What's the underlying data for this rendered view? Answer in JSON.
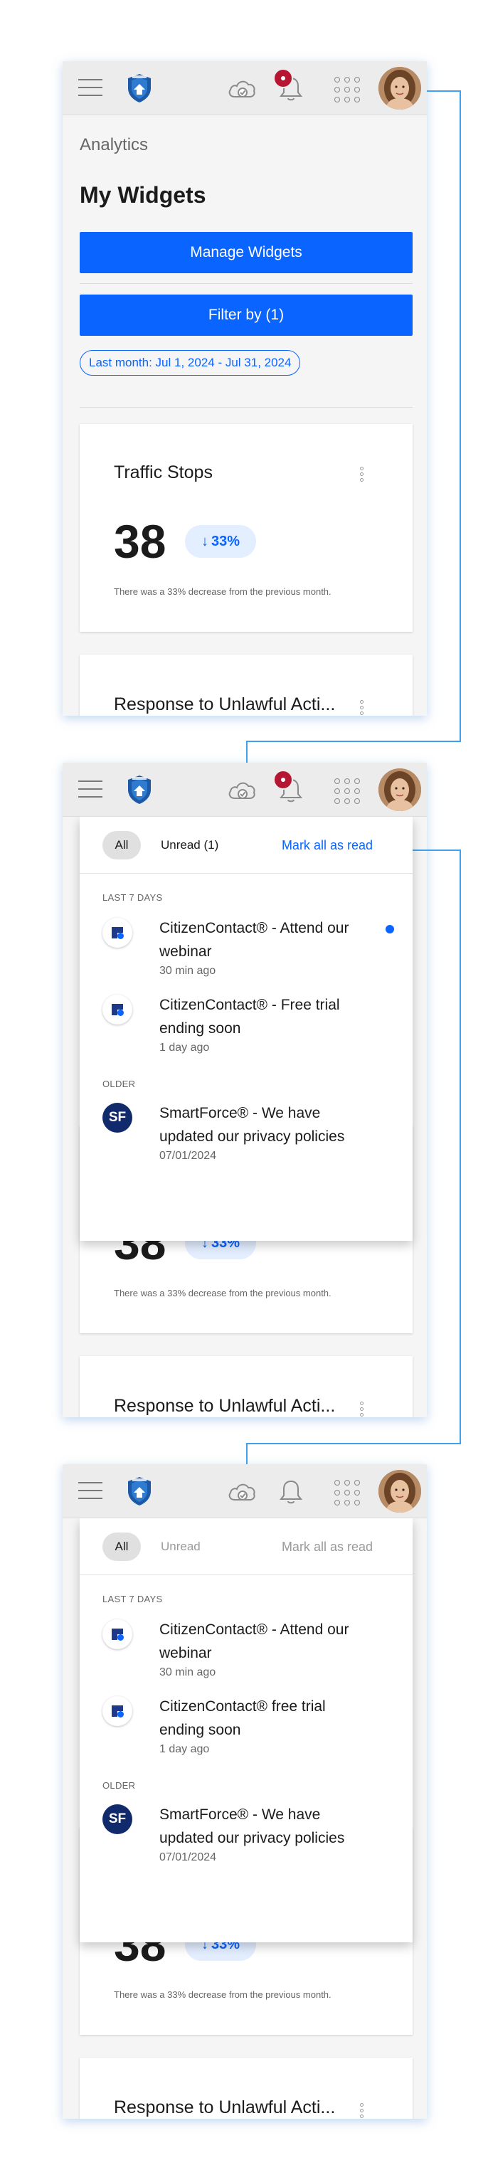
{
  "header": {
    "logo": "police-badge-logo",
    "icons": [
      "menu-icon",
      "cloud-check-icon",
      "bell-icon",
      "apps-grid-icon"
    ],
    "avatar": "user-avatar"
  },
  "page": {
    "breadcrumb": "Analytics",
    "title": "My Widgets",
    "manage_label": "Manage Widgets",
    "filter_label": "Filter by (1)",
    "date_chip": "Last month: Jul 1, 2024 - Jul 31, 2024"
  },
  "widgets": [
    {
      "title": "Traffic Stops",
      "value": "38",
      "trend": "33%",
      "trend_direction": "down",
      "note": "There was a 33% decrease from the previous month."
    },
    {
      "title": "Response to Unlawful Acti..."
    }
  ],
  "notifications_unread_state": {
    "tabs": {
      "all": "All",
      "unread": "Unread (1)"
    },
    "mark_all": "Mark all as read",
    "sections": [
      {
        "label": "LAST 7 DAYS",
        "items": [
          {
            "icon": "citizencontact-icon",
            "title": "CitizenContact® - Attend our webinar",
            "time": "30 min ago",
            "unread": true
          },
          {
            "icon": "citizencontact-icon",
            "title": "CitizenContact® - Free trial ending soon",
            "time": "1 day ago",
            "unread": false
          }
        ]
      },
      {
        "label": "OLDER",
        "items": [
          {
            "icon": "smartforce-icon",
            "icon_text": "SF",
            "title": "SmartForce® - We have updated our privacy policies",
            "time": "07/01/2024",
            "unread": false
          }
        ]
      }
    ]
  },
  "notifications_read_state": {
    "tabs": {
      "all": "All",
      "unread": "Unread"
    },
    "mark_all": "Mark all as read",
    "sections": [
      {
        "label": "LAST 7 DAYS",
        "items": [
          {
            "icon": "citizencontact-icon",
            "title": "CitizenContact® - Attend our webinar",
            "time": "30 min ago"
          },
          {
            "icon": "citizencontact-icon",
            "title": "CitizenContact® free trial ending soon",
            "time": "1 day ago"
          }
        ]
      },
      {
        "label": "OLDER",
        "items": [
          {
            "icon": "smartforce-icon",
            "icon_text": "SF",
            "title": "SmartForce® - We have updated our privacy policies",
            "time": "07/01/2024"
          }
        ]
      }
    ]
  },
  "colors": {
    "primary": "#0a64ff",
    "badge": "#b51632",
    "connector": "#3fa2ee",
    "smartforce": "#112a6b"
  }
}
